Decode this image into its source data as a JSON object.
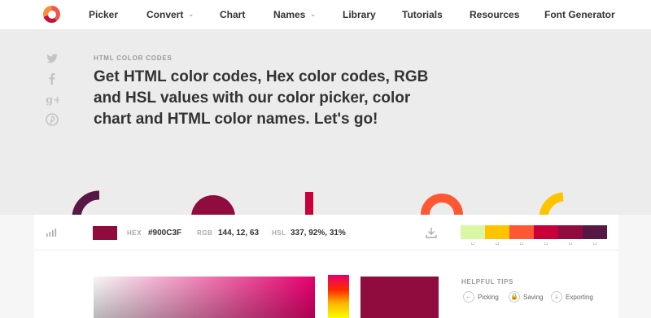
{
  "nav": {
    "items": [
      {
        "label": "Picker",
        "has_dropdown": false
      },
      {
        "label": "Convert",
        "has_dropdown": true
      },
      {
        "label": "Chart",
        "has_dropdown": false
      },
      {
        "label": "Names",
        "has_dropdown": true
      },
      {
        "label": "Library",
        "has_dropdown": false
      },
      {
        "label": "Tutorials",
        "has_dropdown": false
      },
      {
        "label": "Resources",
        "has_dropdown": false
      },
      {
        "label": "Font Generator",
        "has_dropdown": false
      }
    ],
    "dropdown_glyph": "⌄"
  },
  "social": [
    "twitter-icon",
    "facebook-icon",
    "google-plus-icon",
    "pinterest-icon"
  ],
  "hero": {
    "kicker": "HTML COLOR CODES",
    "headline": "Get HTML color codes, Hex color codes, RGB and HSL values with our color picker, color chart and HTML color names. Let's go!"
  },
  "toolbar": {
    "selected_color": "#900C3F",
    "hex_label": "HEX",
    "hex_value": "#900C3F",
    "rgb_label": "RGB",
    "rgb_value": "144, 12, 63",
    "hsl_label": "HSL",
    "hsl_value": "337, 92%, 31%"
  },
  "palette": [
    "#DAF7A6",
    "#FFC300",
    "#FF5733",
    "#C70039",
    "#900C3F",
    "#581845"
  ],
  "tips": {
    "title": "HELPFUL TIPS",
    "items": [
      {
        "label": "Picking",
        "icon": "arrow-left-icon"
      },
      {
        "label": "Saving",
        "icon": "lock-icon"
      },
      {
        "label": "Exporting",
        "icon": "download-icon"
      }
    ]
  },
  "colors": {
    "shape_purple": "#581845",
    "shape_crimson": "#900C3F",
    "shape_red": "#C70039",
    "shape_orange": "#FF5733",
    "shape_yellow": "#FFC300"
  }
}
